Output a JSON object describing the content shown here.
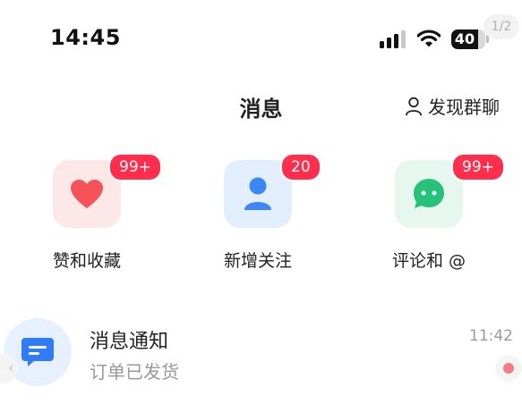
{
  "status_bar": {
    "time": "14:45",
    "battery_level": "40",
    "battery_fraction": 0.4,
    "page_indicator": "1/2"
  },
  "header": {
    "title": "消息",
    "discover_group_label": "发现群聊",
    "discover_group_icon": "person-icon"
  },
  "categories": [
    {
      "label": "赞和收藏",
      "badge": "99+",
      "icon": "heart-icon"
    },
    {
      "label": "新增关注",
      "badge": "20",
      "icon": "person-icon"
    },
    {
      "label": "评论和 @",
      "badge": "99+",
      "icon": "chat-bubble-icon"
    }
  ],
  "messages": [
    {
      "title": "消息通知",
      "preview": "订单已发货",
      "time": "11:42",
      "icon": "notification-message-icon"
    }
  ],
  "colors": {
    "badge": "#ff2e4d",
    "likes_icon": "#f5525a",
    "follow_icon": "#3d86f5",
    "comment_icon": "#27c27a",
    "notification_icon": "#2f7cf6"
  }
}
